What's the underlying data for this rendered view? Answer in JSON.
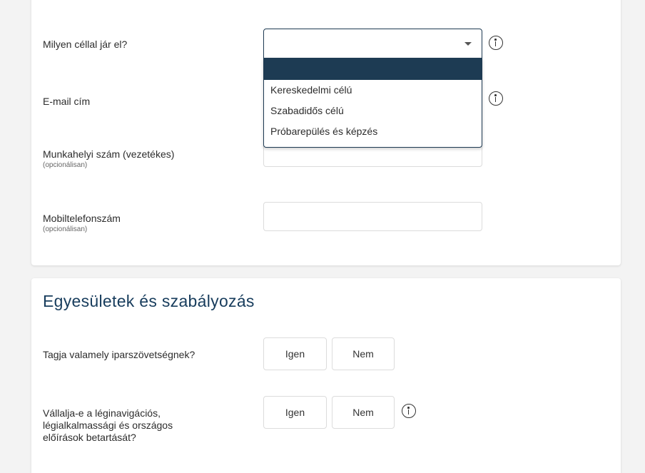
{
  "personal": {
    "purpose_label": "Milyen céllal jár el?",
    "email_label": "E-mail cím",
    "work_phone_label": "Munkahelyi szám (vezetékes)",
    "work_phone_note": "(opcionálisan)",
    "mobile_label": "Mobiltelefonszám",
    "mobile_note": "(opcionálisan)",
    "purpose_value": "",
    "purpose_options": [
      "",
      "Kereskedelmi célú",
      "Szabadidős célú",
      "Próbarepülés és képzés"
    ]
  },
  "associations": {
    "title": "Egyesületek és szabályozás",
    "member_question": "Tagja valamely iparszövetségnek?",
    "compliance_question_line1": "Vállalja-e a léginavigációs,",
    "compliance_question_line2": "légialkalmassági és országos",
    "compliance_question_line3": "előírások betartását?",
    "yes_label": "Igen",
    "no_label": "Nem"
  },
  "icons": {
    "info": "info-circle-icon",
    "dropdown": "chevron-down-icon"
  },
  "colors": {
    "accent": "#1d3b53",
    "title": "#173c5c"
  }
}
